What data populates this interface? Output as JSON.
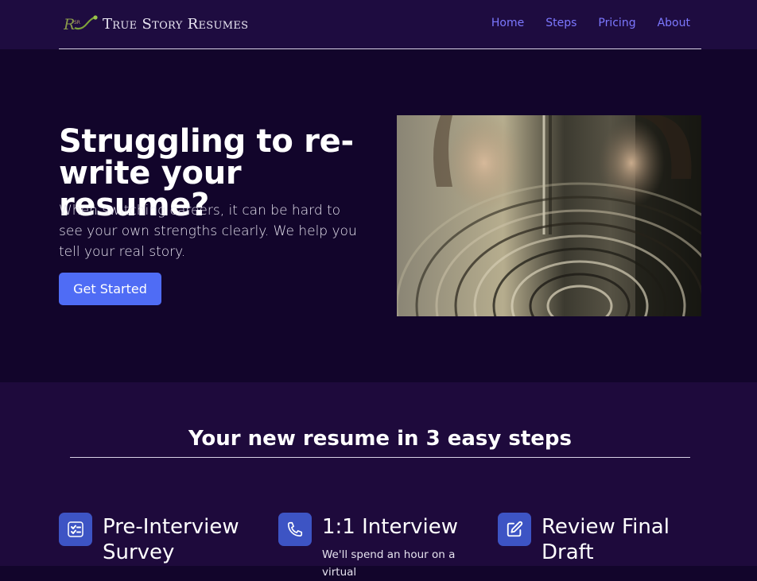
{
  "nav": {
    "brand": "True Story Resumes",
    "links": [
      "Home",
      "Steps",
      "Pricing",
      "About"
    ]
  },
  "hero": {
    "title": "Struggling to re-write your resume?",
    "subtitle": "When switching careers, it can be hard to see your own strengths clearly. We help you tell your real story.",
    "cta": "Get Started"
  },
  "steps": {
    "title": "Your new resume in 3 easy steps",
    "items": [
      {
        "title": "Pre-Interview Survey",
        "description": "",
        "icon": "checklist-icon"
      },
      {
        "title": "1:1 Interview",
        "description": "We'll spend an hour on a virtual",
        "icon": "phone-icon"
      },
      {
        "title": "Review Final Draft",
        "description": "",
        "icon": "edit-icon"
      }
    ]
  },
  "colors": {
    "nav_bg": "#1e0c40",
    "hero_bg": "#12052b",
    "steps_bg": "#1e0a3c",
    "link": "#7c78ff",
    "button": "#4f6cf5",
    "icon_bg": "#3d54c4"
  }
}
